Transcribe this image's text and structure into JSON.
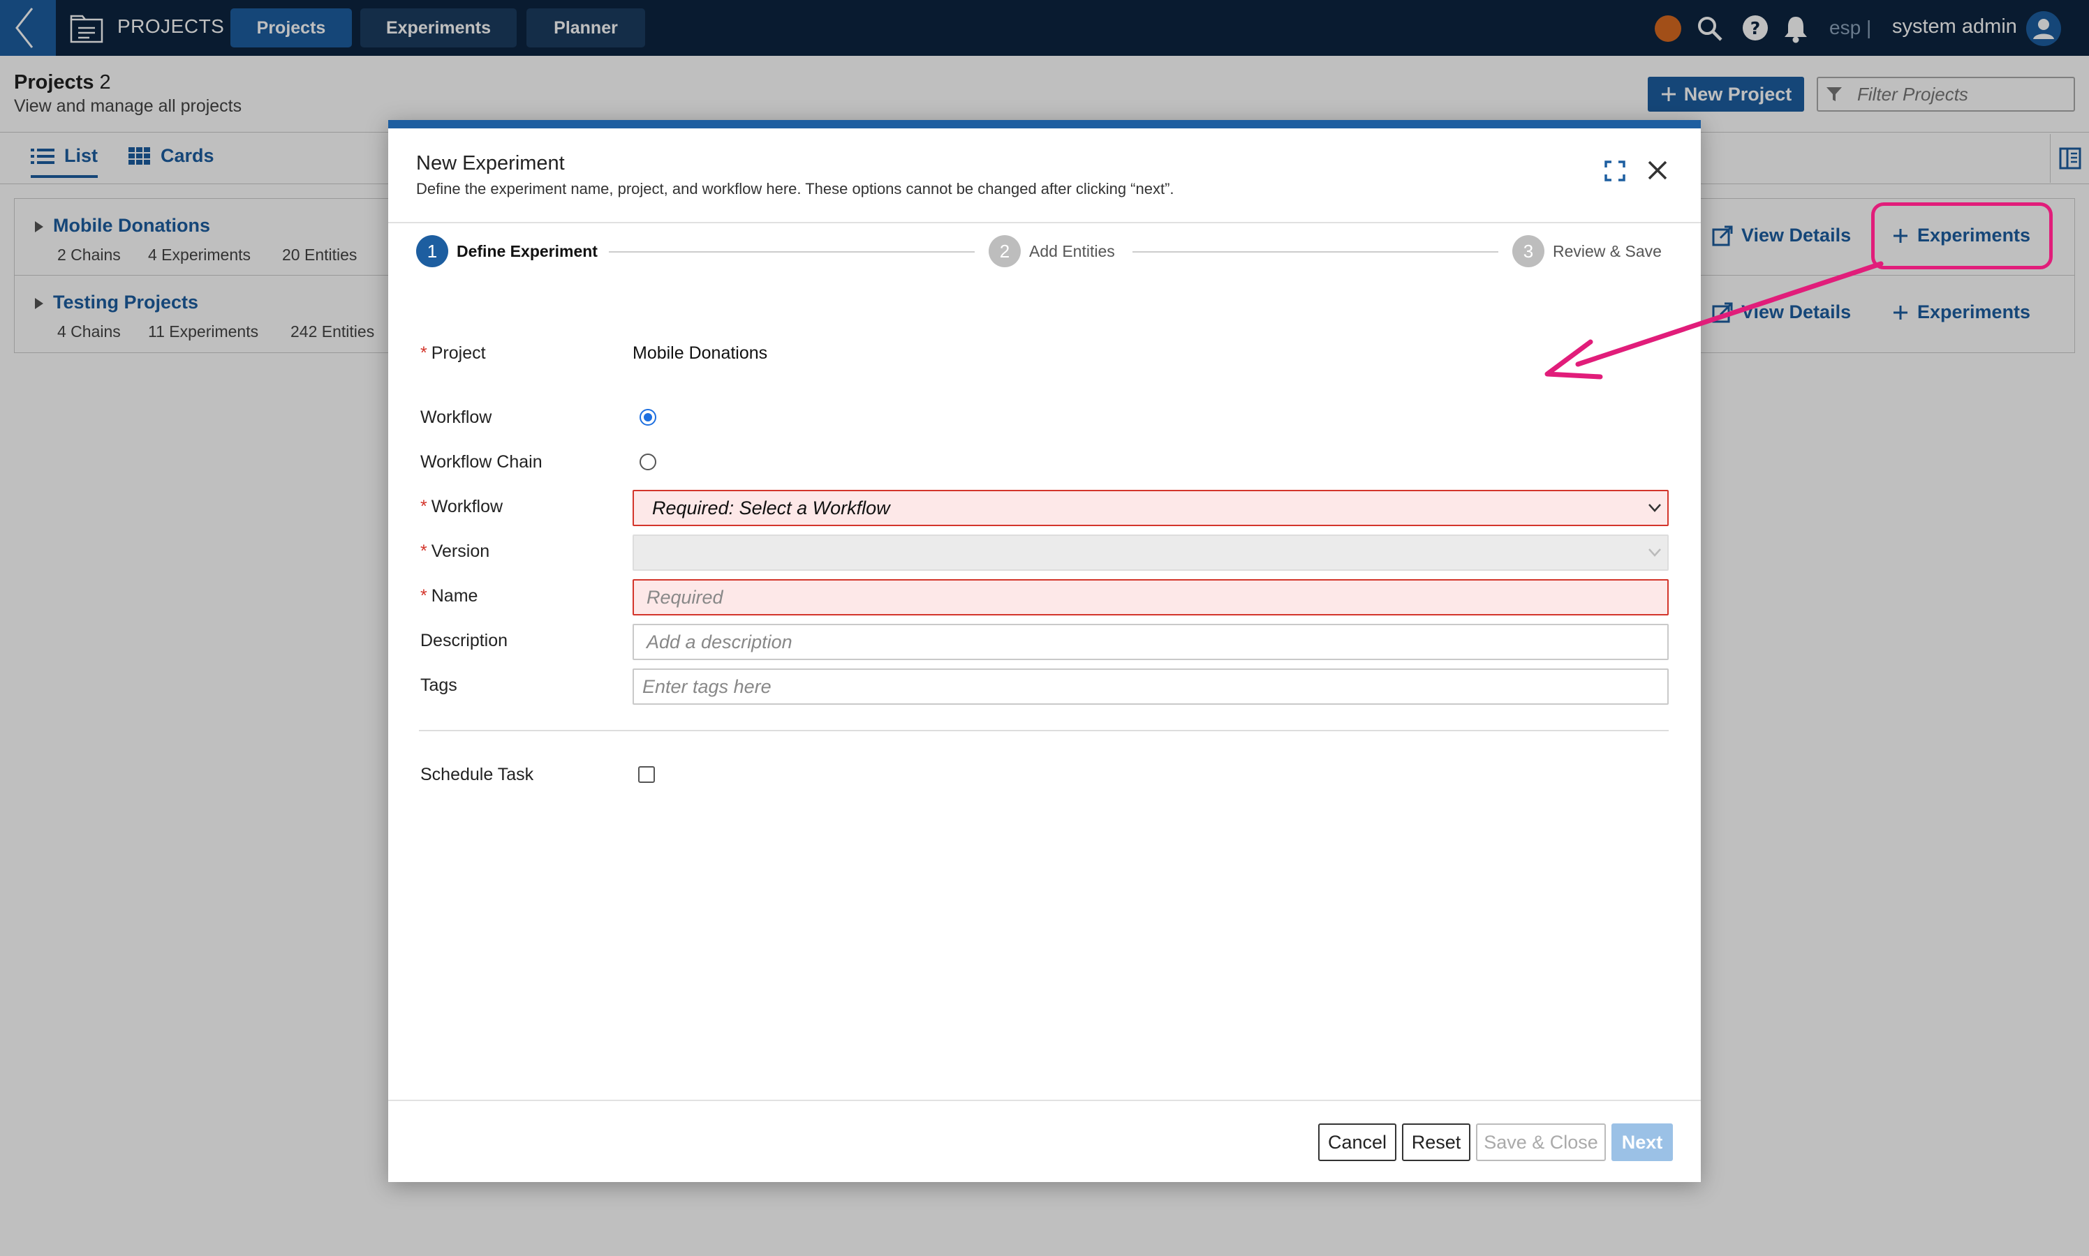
{
  "topbar": {
    "app_title": "PROJECTS",
    "tabs": [
      "Projects",
      "Experiments",
      "Planner"
    ],
    "lab": "esp",
    "separator": "|",
    "user": "system admin"
  },
  "page": {
    "title": "Projects",
    "count": "2",
    "subtitle": "View and manage all projects",
    "new_project_label": "New Project",
    "filter_placeholder": "Filter Projects",
    "view_tabs": [
      "List",
      "Cards"
    ]
  },
  "projects": [
    {
      "name": "Mobile Donations",
      "chains": "2 Chains",
      "experiments": "4 Experiments",
      "entities": "20 Entities"
    },
    {
      "name": "Testing Projects",
      "chains": "4 Chains",
      "experiments": "11 Experiments",
      "entities": "242 Entities"
    }
  ],
  "row_actions": {
    "view_details": "View Details",
    "experiments": "Experiments"
  },
  "modal": {
    "title": "New Experiment",
    "description": "Define the experiment name, project, and workflow here. These options cannot be changed after clicking “next”.",
    "steps": [
      {
        "num": "1",
        "label": "Define Experiment"
      },
      {
        "num": "2",
        "label": "Add Entities"
      },
      {
        "num": "3",
        "label": "Review & Save"
      }
    ],
    "required_mark": "*",
    "form": {
      "project_label": "Project",
      "project_value": "Mobile Donations",
      "workflow_radio_label": "Workflow",
      "chain_radio_label": "Workflow Chain",
      "workflow_label": "Workflow",
      "workflow_placeholder": "Required: Select a Workflow",
      "version_label": "Version",
      "name_label": "Name",
      "name_placeholder": "Required",
      "description_label": "Description",
      "description_placeholder": "Add a description",
      "tags_label": "Tags",
      "tags_placeholder": "Enter tags here",
      "schedule_label": "Schedule Task"
    },
    "buttons": {
      "cancel": "Cancel",
      "reset": "Reset",
      "save_close": "Save & Close",
      "next": "Next"
    }
  },
  "colors": {
    "primary": "#1d5ea0",
    "nav": "#0c2540",
    "error": "#d3352b",
    "annotation": "#e11d7a",
    "status": "#d86a21"
  }
}
